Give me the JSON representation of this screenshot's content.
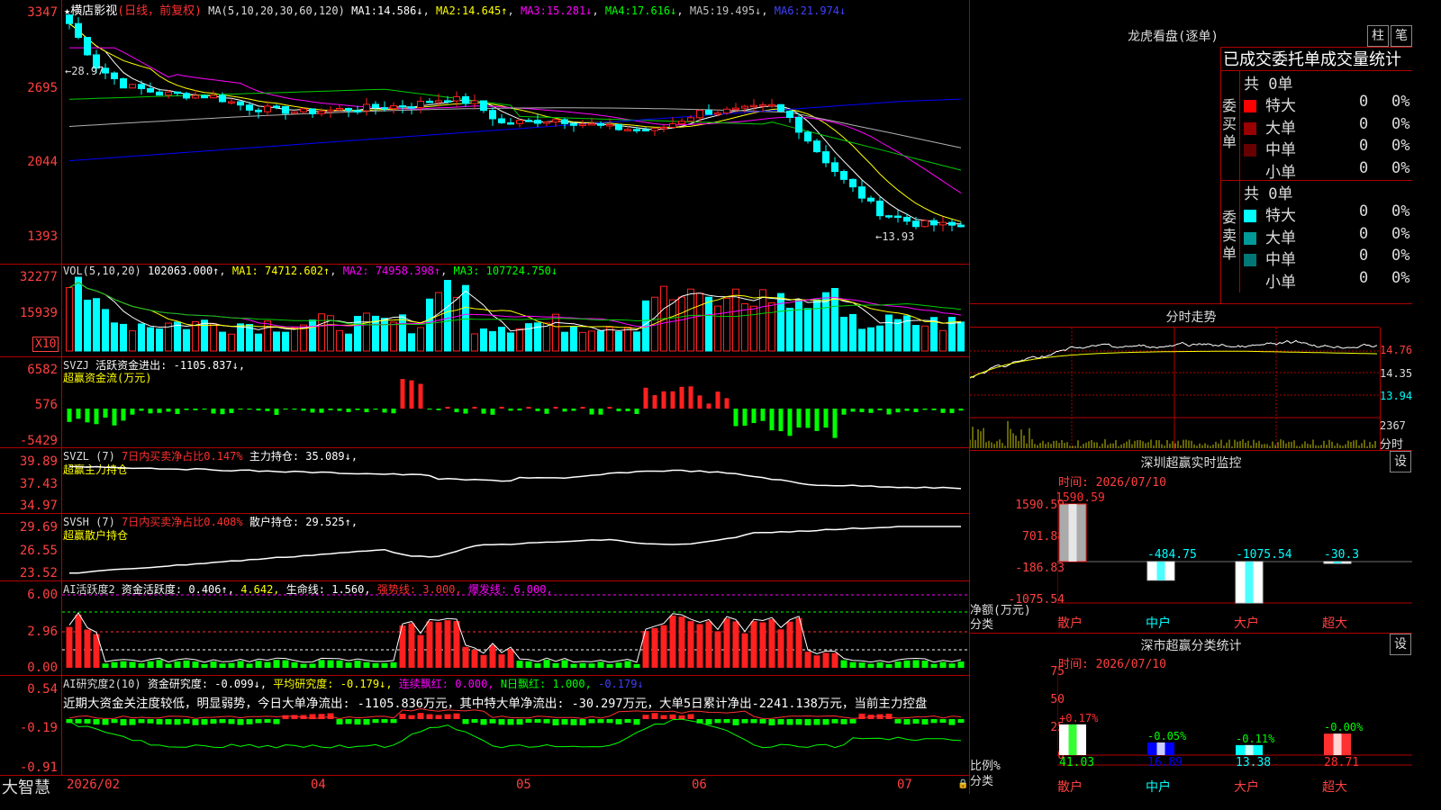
{
  "colors": {
    "up": "#ff2020",
    "down": "#00ffff",
    "bg": "#000000",
    "grid": "#b00000",
    "ma1": "#ffffff",
    "ma2": "#ffff00",
    "ma3": "#ff00ff",
    "ma4": "#00cc00",
    "ma5": "#b0b0b0",
    "ma6": "#0000ff"
  },
  "header": {
    "star": "★",
    "stock": "横店影视",
    "mode": "(日线，前复权)",
    "ma_label": "MA(5,10,20,30,60,120)",
    "ma": [
      {
        "name": "MA1:",
        "value": "14.586↓"
      },
      {
        "name": "MA2:",
        "value": "14.645↑"
      },
      {
        "name": "MA3:",
        "value": "15.281↓"
      },
      {
        "name": "MA4:",
        "value": "17.616↓"
      },
      {
        "name": "MA5:",
        "value": "19.495↓"
      },
      {
        "name": "MA6:",
        "value": "21.974↓"
      }
    ]
  },
  "price_axis": [
    "3347",
    "2695",
    "2044",
    "1393"
  ],
  "price_annotations": {
    "high": "←28.97",
    "low": "←13.93"
  },
  "vol": {
    "label": "VOL(5,10,20)",
    "value": "102063.000↑",
    "ma1": "MA1: 74712.602↑",
    "ma2": "MA2: 74958.398↑",
    "ma3": "MA3: 107724.750↓",
    "axis": [
      "32277",
      "15939"
    ],
    "unit": "X10"
  },
  "svzj": {
    "label": "SVZJ",
    "text": "活跃资金进出: -1105.837↓,",
    "sub": "超赢资金流(万元)",
    "axis": [
      "6582",
      "576",
      "-5429"
    ]
  },
  "svzl": {
    "label": "SVZL (7)",
    "text": "7日内买卖净占比0.147%",
    "text2": "主力持仓: 35.089↓,",
    "sub": "超赢主力持仓",
    "axis": [
      "39.89",
      "37.43",
      "34.97"
    ]
  },
  "svsh": {
    "label": "SVSH (7)",
    "text": "7日内买卖净占比0.408%",
    "text2": "散户持仓: 29.525↑,",
    "sub": "超赢散户持仓",
    "axis": [
      "29.69",
      "26.55",
      "23.52"
    ]
  },
  "ai1": {
    "label": "AI活跃度2",
    "t1": "资金活跃度: 0.406↑,",
    "t2": "4.642,",
    "t3": "生命线: 1.560,",
    "t4": "强势线: 3.000,",
    "t5": "爆发线: 6.000,",
    "axis": [
      "6.00",
      "2.96",
      "0.00"
    ]
  },
  "ai2": {
    "label": "AI研究度2(10)",
    "t1": "资金研究度: -0.099↓,",
    "t2": "平均研究度: -0.179↓,",
    "t3": "连续飘红: 0.000,",
    "t4": "N日飘红: 1.000,",
    "t5": "-0.179↓",
    "note": "近期大资金关注度较低，明显弱势，今日大单净流出: -1105.836万元，其中特大单净流出: -30.297万元，大单5日累计净出-2241.138万元，当前主力控盘",
    "axis": [
      "0.54",
      "-0.19",
      "-0.91"
    ]
  },
  "xaxis": {
    "brand": "大智慧",
    "labels": [
      "2026/02",
      "04",
      "05",
      "06",
      "07"
    ]
  },
  "lhb": {
    "title": "龙虎看盘(逐单)",
    "btn1": "柱",
    "btn2": "笔",
    "head": "已成交委托单成交量统计",
    "buy": {
      "label": "委买单",
      "total": "共 0单",
      "rows": [
        {
          "name": "特大",
          "v": "0",
          "p": "0%",
          "c": "#ff0000"
        },
        {
          "name": "大单",
          "v": "0",
          "p": "0%",
          "c": "#990000"
        },
        {
          "name": "中单",
          "v": "0",
          "p": "0%",
          "c": "#660000"
        },
        {
          "name": "小单",
          "v": "0",
          "p": "0%",
          "c": "#000000"
        }
      ]
    },
    "sell": {
      "label": "委卖单",
      "total": "共 0单",
      "rows": [
        {
          "name": "特大",
          "v": "0",
          "p": "0%",
          "c": "#00ffff"
        },
        {
          "name": "大单",
          "v": "0",
          "p": "0%",
          "c": "#009999"
        },
        {
          "name": "中单",
          "v": "0",
          "p": "0%",
          "c": "#007777"
        },
        {
          "name": "小单",
          "v": "0",
          "p": "0%",
          "c": "#000000"
        }
      ]
    }
  },
  "intraday": {
    "title": "分时走势",
    "axis": [
      "14.76",
      "14.35",
      "13.94"
    ],
    "vol": "2367",
    "unit": "分时"
  },
  "szrt": {
    "title": "深圳超赢实时监控",
    "btn": "设",
    "time": "时间: 2026/07/10",
    "axis": [
      "1590.59",
      "701.88",
      "-186.83",
      "-1075.54"
    ],
    "ylabel": "净额(万元)",
    "xlabel": "分类",
    "chart_data": {
      "type": "bar",
      "categories": [
        "散户",
        "中户",
        "大户",
        "超大"
      ],
      "values": [
        1590.59,
        -484.75,
        -1075.54,
        -30.3
      ],
      "labels": [
        "1590.59",
        "-484.75",
        "-1075.54",
        "-30.3"
      ],
      "ylim": [
        -1075.54,
        1590.59
      ]
    }
  },
  "szcls": {
    "title": "深市超赢分类统计",
    "btn": "设",
    "time": "时间: 2026/07/10",
    "axis": [
      "75",
      "50",
      "25",
      "0"
    ],
    "ylabel": "比例%",
    "xlabel": "分类",
    "chart_data": {
      "type": "bar",
      "categories": [
        "散户",
        "中户",
        "大户",
        "超大"
      ],
      "values": [
        41.03,
        16.89,
        13.38,
        28.71
      ],
      "changes": [
        "+0.17%",
        "-0.05%",
        "-0.11%",
        "-0.00%"
      ],
      "values_text": [
        "41.03",
        "16.89",
        "13.38",
        "28.71"
      ],
      "ylim": [
        0,
        75
      ]
    }
  }
}
